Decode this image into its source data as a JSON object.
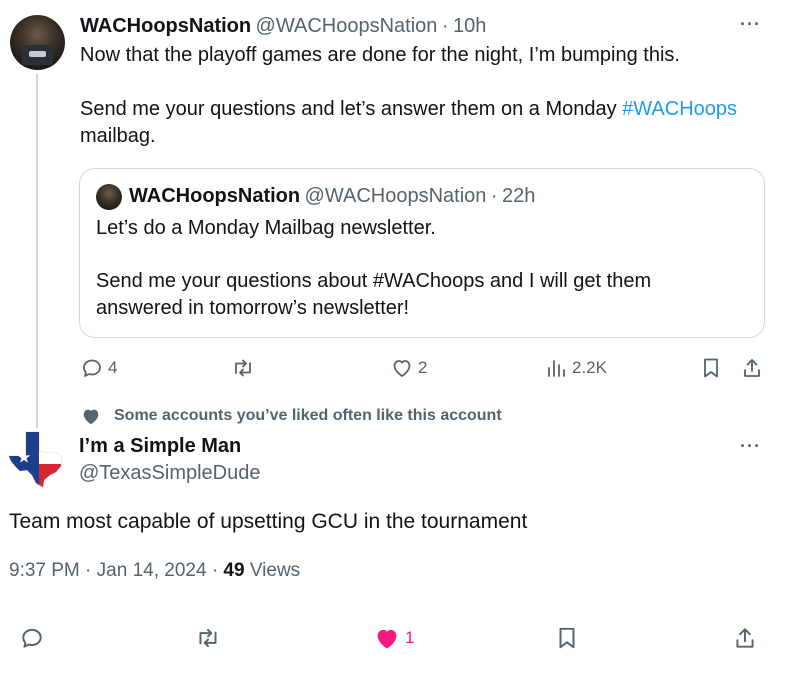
{
  "parent_tweet": {
    "display_name": "WACHoopsNation",
    "handle": "@WACHoopsNation",
    "separator": "·",
    "time": "10h",
    "more": "···",
    "text_line1": "Now that the playoff games are done for the night, I’m bumping this.",
    "text_line2_prefix": "Send me your questions and let’s answer them on a Monday ",
    "text_line2_hashtag": "#WACHoops",
    "text_line3": "mailbag.",
    "quote": {
      "display_name": "WACHoopsNation",
      "handle": "@WACHoopsNation",
      "separator": "·",
      "time": "22h",
      "line1": "Let’s do a Monday Mailbag newsletter.",
      "line2": "Send me your questions about #WAChoops and I will get them",
      "line3": "answered in tomorrow’s newsletter!"
    },
    "actions": {
      "replies": "4",
      "likes": "2",
      "views": "2.2K"
    }
  },
  "liked_note": "Some accounts you’ve liked often like this account",
  "main_tweet": {
    "display_name": "I’m a Simple Man",
    "handle": "@TexasSimpleDude",
    "more": "···",
    "text": "Team most capable of upsetting GCU in the tournament",
    "time": "9:37 PM",
    "separator1": "·",
    "date": "Jan 14, 2024",
    "separator2": "·",
    "views_count": "49",
    "views_label": "Views",
    "likes": "1"
  },
  "colors": {
    "text": "#0f1419",
    "muted": "#536471",
    "link": "#1d9bf0",
    "like_active": "#f91880",
    "border": "#cfd9de"
  }
}
